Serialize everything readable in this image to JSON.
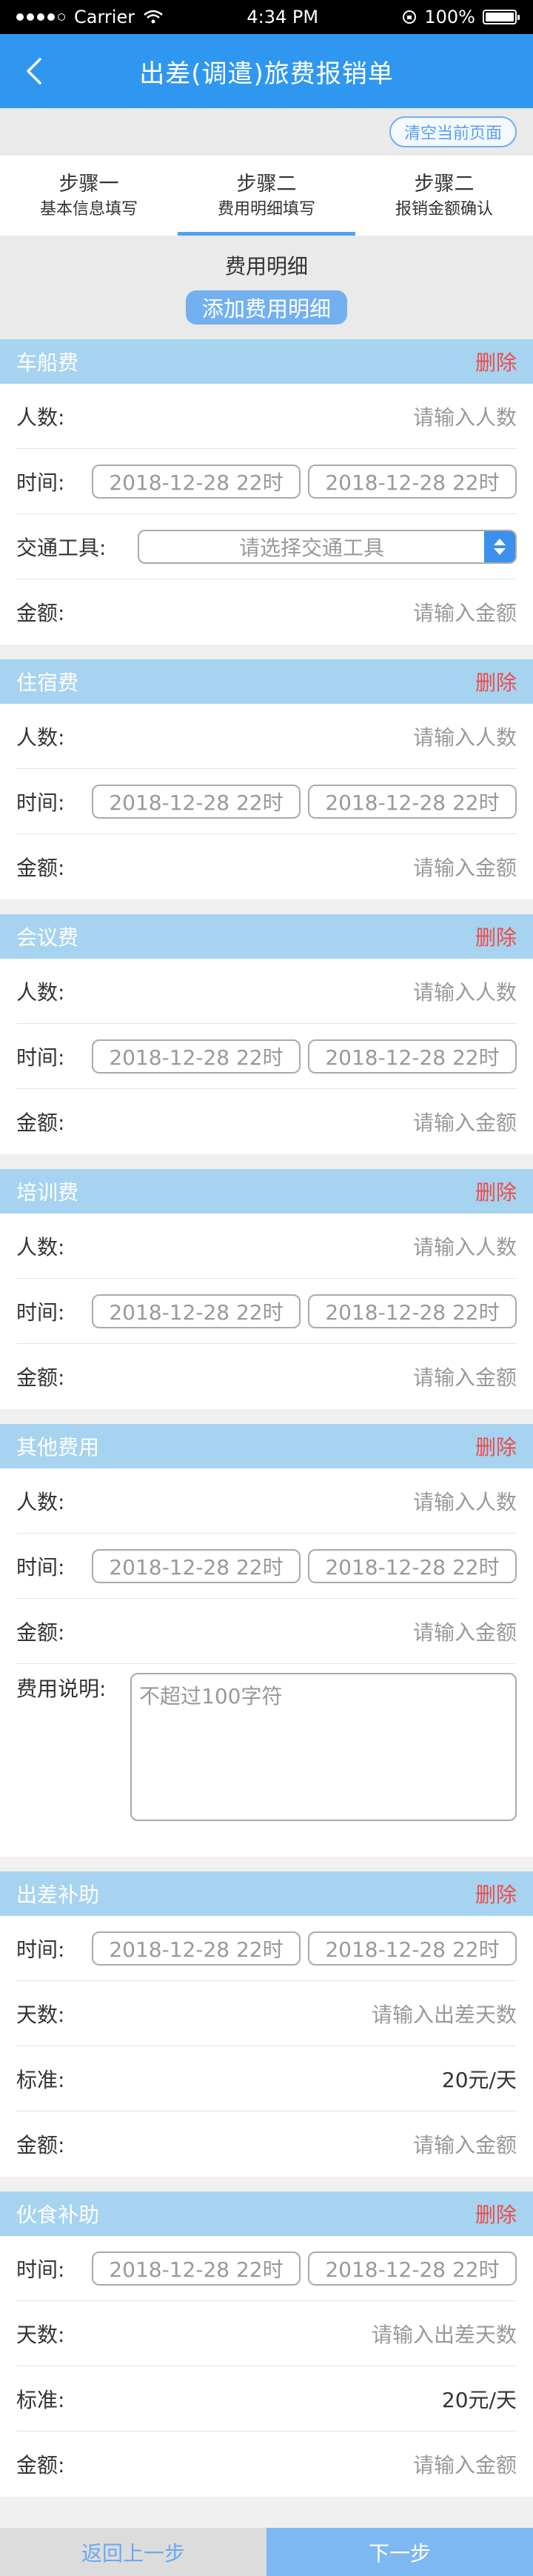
{
  "status_bar": {
    "carrier": "Carrier",
    "time": "4:34 PM",
    "battery": "100%"
  },
  "nav": {
    "title": "出差(调遣)旅费报销单"
  },
  "clear_button": "清空当前页面",
  "steps": [
    {
      "title": "步骤一",
      "subtitle": "基本信息填写"
    },
    {
      "title": "步骤二",
      "subtitle": "费用明细填写"
    },
    {
      "title": "步骤二",
      "subtitle": "报销金额确认"
    }
  ],
  "detail": {
    "title": "费用明细",
    "add_button": "添加费用明细"
  },
  "common": {
    "delete": "删除",
    "people_label": "人数:",
    "people_placeholder": "请输入人数",
    "time_label": "时间:",
    "date_start": "2018-12-28  22时",
    "date_end": "2018-12-28  22时",
    "amount_label": "金额:",
    "amount_placeholder": "请输入金额",
    "days_label": "天数:",
    "days_placeholder": "请输入出差天数",
    "standard_label": "标准:",
    "standard_value": "20元/天"
  },
  "sections": {
    "transport": {
      "title": "车船费",
      "vehicle_label": "交通工具:",
      "vehicle_placeholder": "请选择交通工具"
    },
    "lodging": {
      "title": "住宿费"
    },
    "meeting": {
      "title": "会议费"
    },
    "training": {
      "title": "培训费"
    },
    "other": {
      "title": "其他费用",
      "note_label": "费用说明:",
      "note_placeholder": "不超过100字符"
    },
    "travel_allowance": {
      "title": "出差补助"
    },
    "meal_allowance": {
      "title": "伙食补助"
    }
  },
  "bottom": {
    "prev": "返回上一步",
    "next": "下一步"
  },
  "colors": {
    "nav_blue": "#2f97f0",
    "section_header": "#a6d3ef",
    "delete_red": "#ef4a4a"
  }
}
